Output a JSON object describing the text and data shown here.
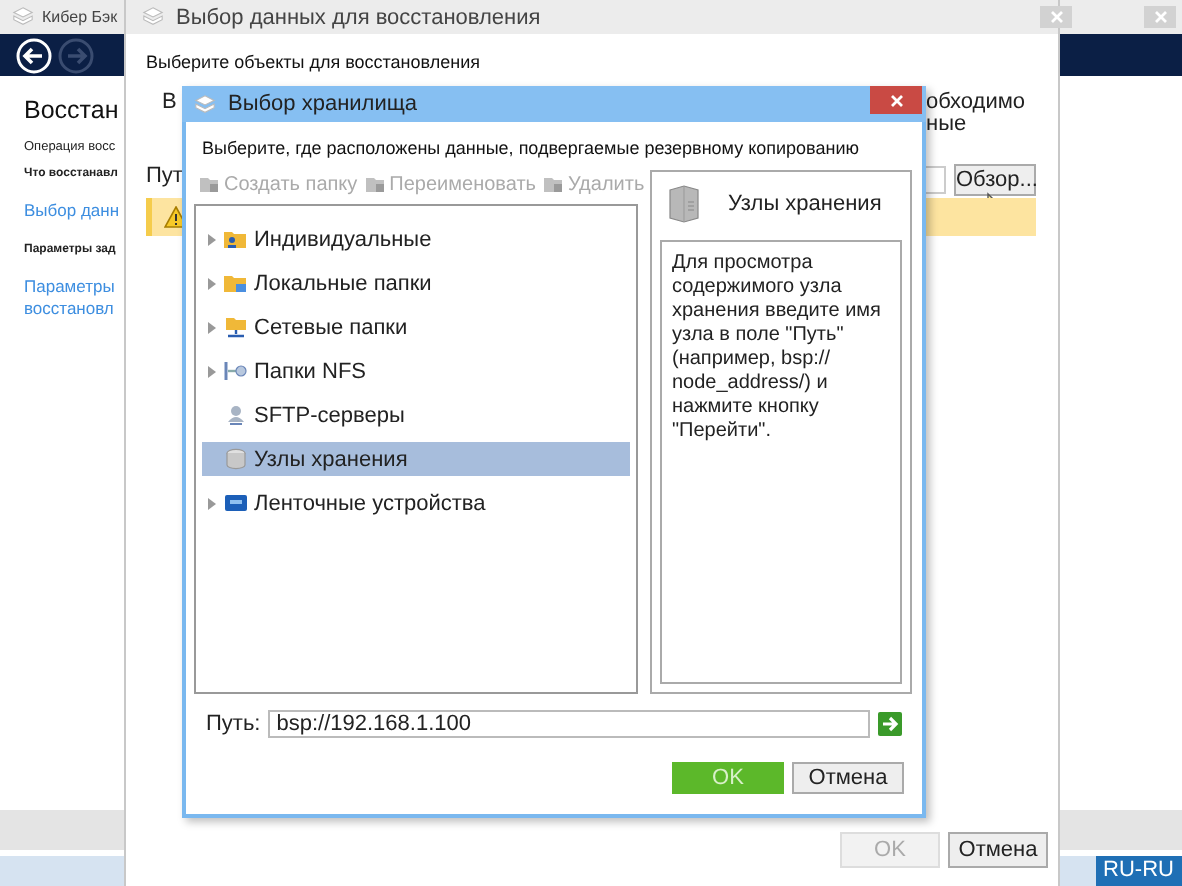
{
  "main_window": {
    "title": "Кибер Бэк",
    "heading": "Восстан",
    "operation_label": "Операция восс",
    "what_label": "Что восстанавл",
    "data_link": "Выбор данн",
    "params_label": "Параметры зад",
    "params_link": "Параметры восстановл"
  },
  "restore_window": {
    "title": "Выбор данных для восстановления",
    "instruction": "Выберите объекты для восстановления",
    "left_fragment": "В",
    "right_fragments": [
      "обходимо",
      "ные"
    ],
    "path_label": "Пут",
    "browse_button": "Обзор...",
    "warning": true,
    "buttons": [
      {
        "label": "OK",
        "disabled": true
      },
      {
        "label": "Отмена",
        "disabled": false
      }
    ]
  },
  "dialog": {
    "title": "Выбор хранилища",
    "instruction": "Выберите, где расположены данные, подвергаемые резервному копированию",
    "toolbar": [
      {
        "label": "Создать папку",
        "disabled": true
      },
      {
        "label": "Переименовать",
        "disabled": true
      },
      {
        "label": "Удалить",
        "disabled": true
      }
    ],
    "tree": [
      {
        "label": "Индивидуальные",
        "kind": "personal",
        "expandable": true,
        "selected": false
      },
      {
        "label": "Локальные папки",
        "kind": "local",
        "expandable": true,
        "selected": false
      },
      {
        "label": "Сетевые папки",
        "kind": "network",
        "expandable": true,
        "selected": false
      },
      {
        "label": "Папки NFS",
        "kind": "nfs",
        "expandable": true,
        "selected": false
      },
      {
        "label": "SFTP-серверы",
        "kind": "sftp",
        "expandable": false,
        "selected": false
      },
      {
        "label": "Узлы хранения",
        "kind": "node",
        "expandable": false,
        "selected": true
      },
      {
        "label": "Ленточные устройства",
        "kind": "tape",
        "expandable": true,
        "selected": false
      }
    ],
    "info_title": "Узлы хранения",
    "info_text": "Для просмотра содержимого узла хранения введите имя узла в поле \"Путь\" (например, bsp:// node_address/) и нажмите кнопку \"Перейти\".",
    "path_label": "Путь:",
    "path_value": "bsp://192.168.1.100",
    "buttons": [
      {
        "label": "OK",
        "kind": "primary"
      },
      {
        "label": "Отмена",
        "kind": "normal"
      }
    ]
  },
  "taskbar": {
    "language": "RU-RU"
  }
}
